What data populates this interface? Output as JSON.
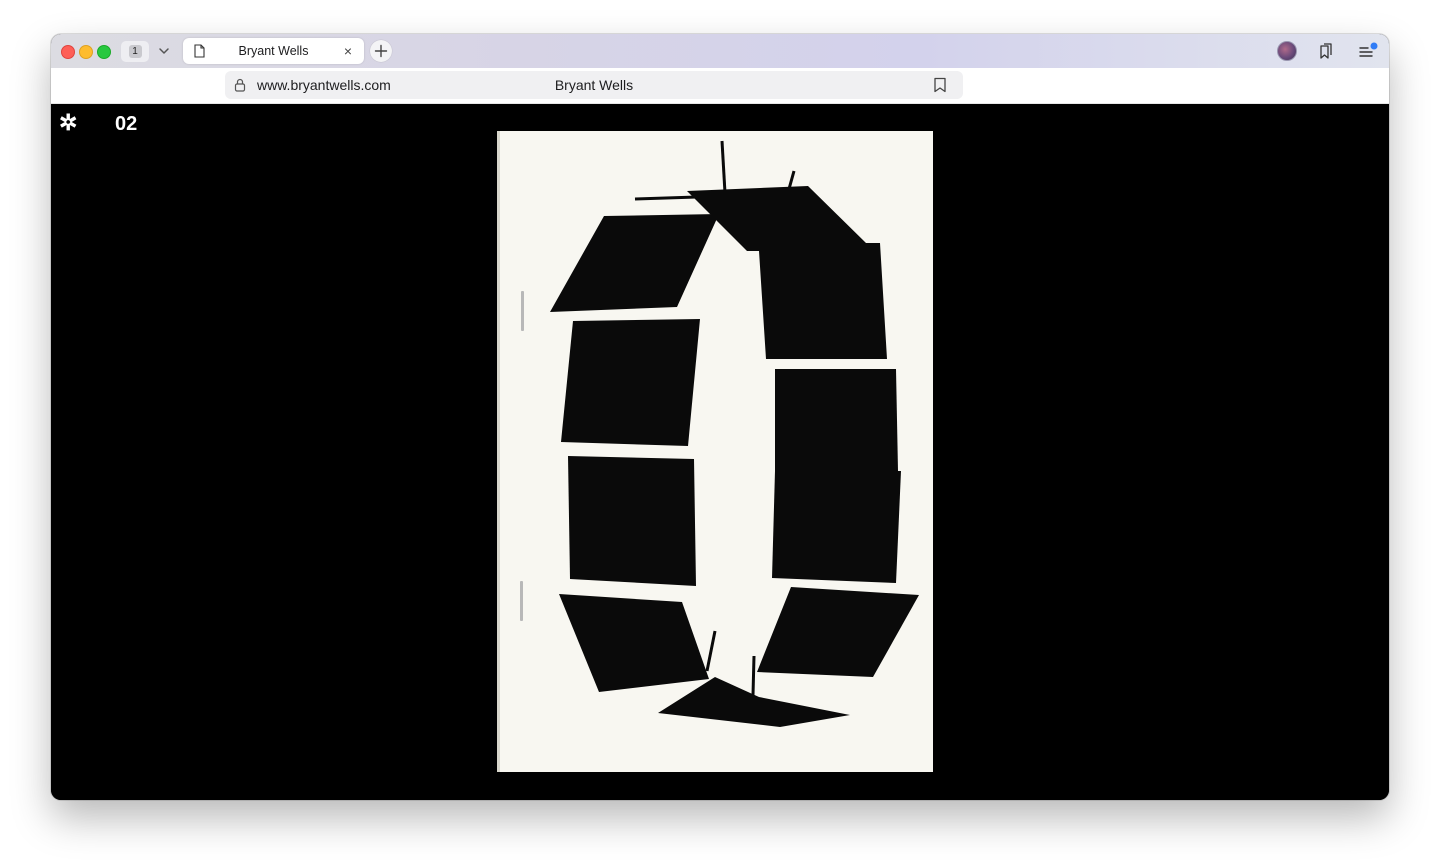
{
  "browser": {
    "tab_count": "1",
    "tab_title": "Bryant Wells",
    "tab_close": "×",
    "address_url": "www.bryantwells.com",
    "address_title": "Bryant Wells"
  },
  "page": {
    "logo_glyph": "✲",
    "page_number": "02"
  },
  "icons": {
    "tab_doc": "document-icon",
    "lock": "lock-icon",
    "bookmark": "bookmark-icon",
    "new_tab": "plus-icon",
    "bookmarks": "bookmarks-icon",
    "menu": "menu-icon"
  },
  "colors": {
    "content_bg": "#000000",
    "paper": "#f8f7f1",
    "ink": "#0a0a0a"
  }
}
